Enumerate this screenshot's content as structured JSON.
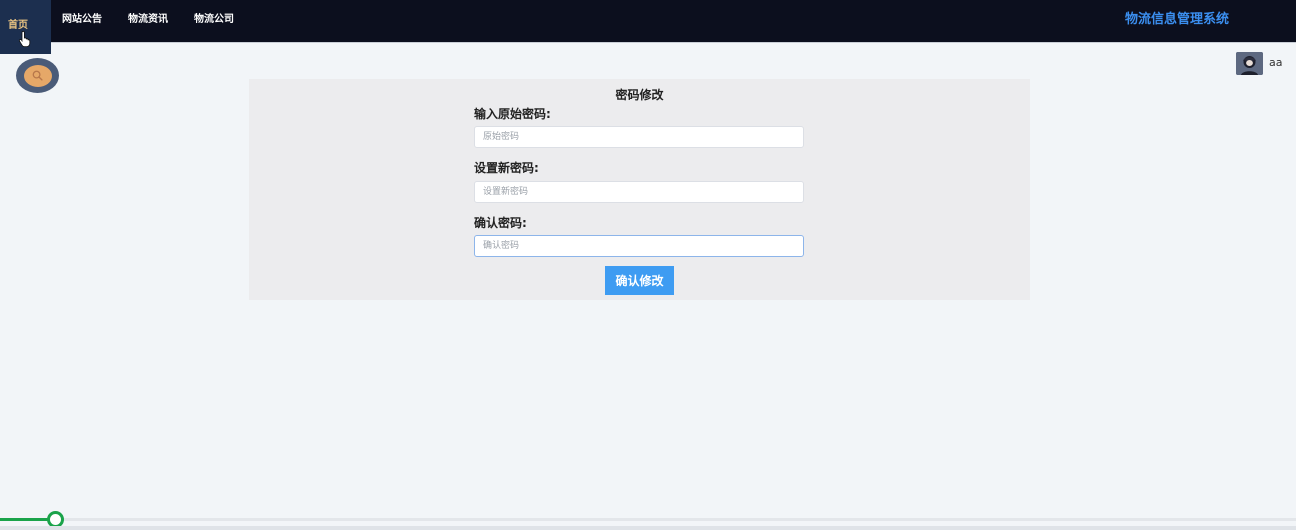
{
  "nav": {
    "home": "首页",
    "items": [
      "网站公告",
      "物流资讯",
      "物流公司"
    ],
    "brand": "物流信息管理系统"
  },
  "user": {
    "name": "aa"
  },
  "form": {
    "title": "密码修改",
    "old_label": "输入原始密码:",
    "old_placeholder": "原始密码",
    "new_label": "设置新密码:",
    "new_placeholder": "设置新密码",
    "confirm_label": "确认密码:",
    "confirm_placeholder": "确认密码",
    "submit": "确认修改"
  },
  "slider": {
    "value_percent": 4.3
  },
  "colors": {
    "accent": "#3e9cf2",
    "topbar": "#0c0f1e",
    "brand": "#3b8ff0",
    "slider": "#1aa34a"
  }
}
